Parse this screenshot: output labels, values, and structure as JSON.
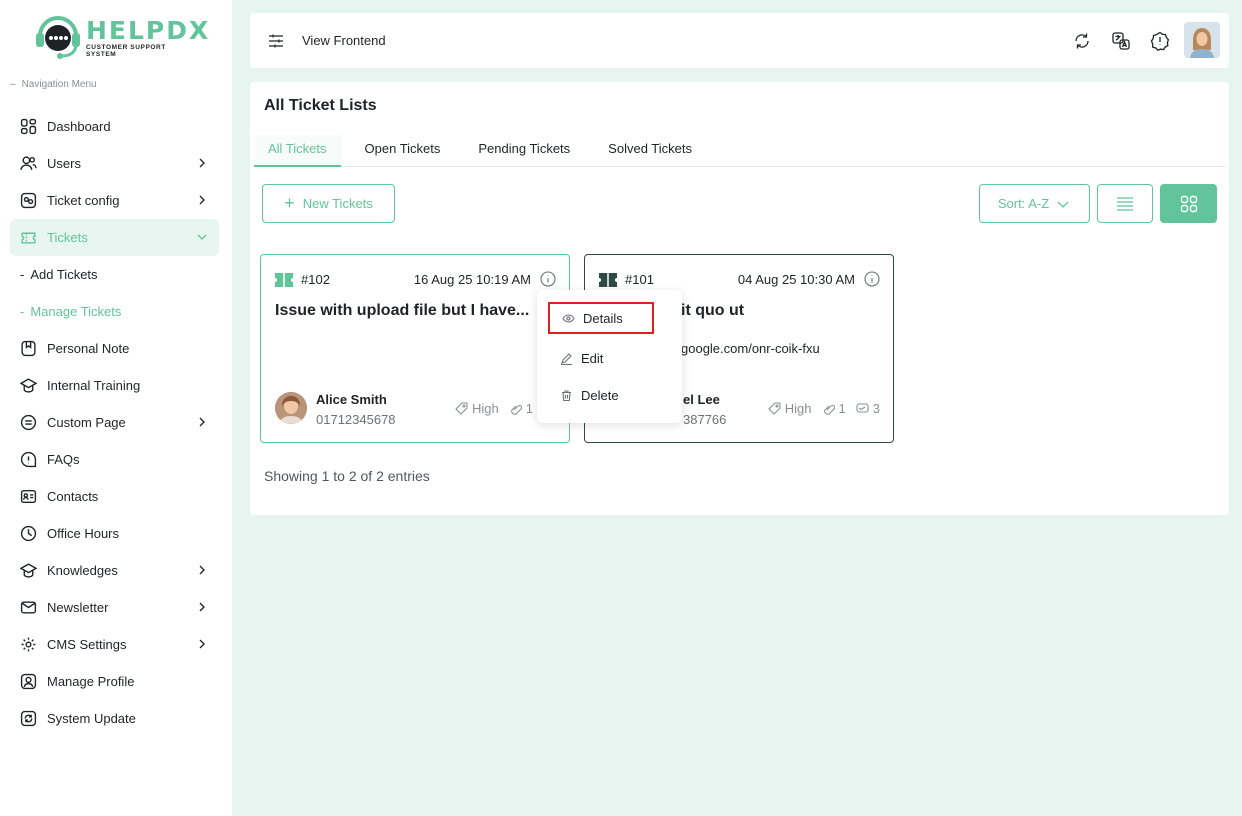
{
  "brand": {
    "name": "HELPDX",
    "tagline": "CUSTOMER SUPPORT SYSTEM",
    "accent": "#62c49a"
  },
  "sidebar": {
    "caption": "Navigation Menu",
    "items": [
      {
        "label": "Dashboard",
        "icon": "dashboard-icon",
        "chevron": false
      },
      {
        "label": "Users",
        "icon": "users-icon",
        "chevron": true
      },
      {
        "label": "Ticket config",
        "icon": "ticket-config-icon",
        "chevron": true
      },
      {
        "label": "Tickets",
        "icon": "ticket-icon",
        "chevron": true,
        "active": true
      },
      {
        "label": "Personal Note",
        "icon": "note-icon",
        "chevron": false
      },
      {
        "label": "Internal Training",
        "icon": "training-icon",
        "chevron": false
      },
      {
        "label": "Custom Page",
        "icon": "page-icon",
        "chevron": true
      },
      {
        "label": "FAQs",
        "icon": "faq-icon",
        "chevron": false
      },
      {
        "label": "Contacts",
        "icon": "contacts-icon",
        "chevron": false
      },
      {
        "label": "Office Hours",
        "icon": "clock-icon",
        "chevron": false
      },
      {
        "label": "Knowledges",
        "icon": "knowledge-icon",
        "chevron": true
      },
      {
        "label": "Newsletter",
        "icon": "newsletter-icon",
        "chevron": true
      },
      {
        "label": "CMS Settings",
        "icon": "settings-icon",
        "chevron": true
      },
      {
        "label": "Manage Profile",
        "icon": "profile-icon",
        "chevron": false
      },
      {
        "label": "System Update",
        "icon": "update-icon",
        "chevron": false
      }
    ],
    "subitems": [
      {
        "label": "Add Tickets"
      },
      {
        "label": "Manage Tickets",
        "active": true
      }
    ]
  },
  "topbar": {
    "view_frontend": "View Frontend"
  },
  "page": {
    "title": "All Ticket Lists",
    "tabs": [
      "All Tickets",
      "Open Tickets",
      "Pending Tickets",
      "Solved Tickets"
    ],
    "new_button": "New Tickets",
    "sort_label": "Sort: A-Z",
    "showing": "Showing 1 to 2 of 2 entries"
  },
  "tickets": [
    {
      "id": "#102",
      "date": "16 Aug 25 10:19 AM",
      "title": "Issue with upload file but I have...",
      "link": "",
      "name": "Alice Smith",
      "phone": "01712345678",
      "priority": "High",
      "attachments": "1",
      "replies": ""
    },
    {
      "id": "#101",
      "date": "04 Aug 25 10:30 AM",
      "title": "it quo ut",
      "link": "google.com/onr-coik-fxu",
      "name": "el Lee",
      "phone": "387766",
      "priority": "High",
      "attachments": "1",
      "replies": "3"
    }
  ],
  "dropdown": {
    "details": "Details",
    "edit": "Edit",
    "delete": "Delete"
  }
}
